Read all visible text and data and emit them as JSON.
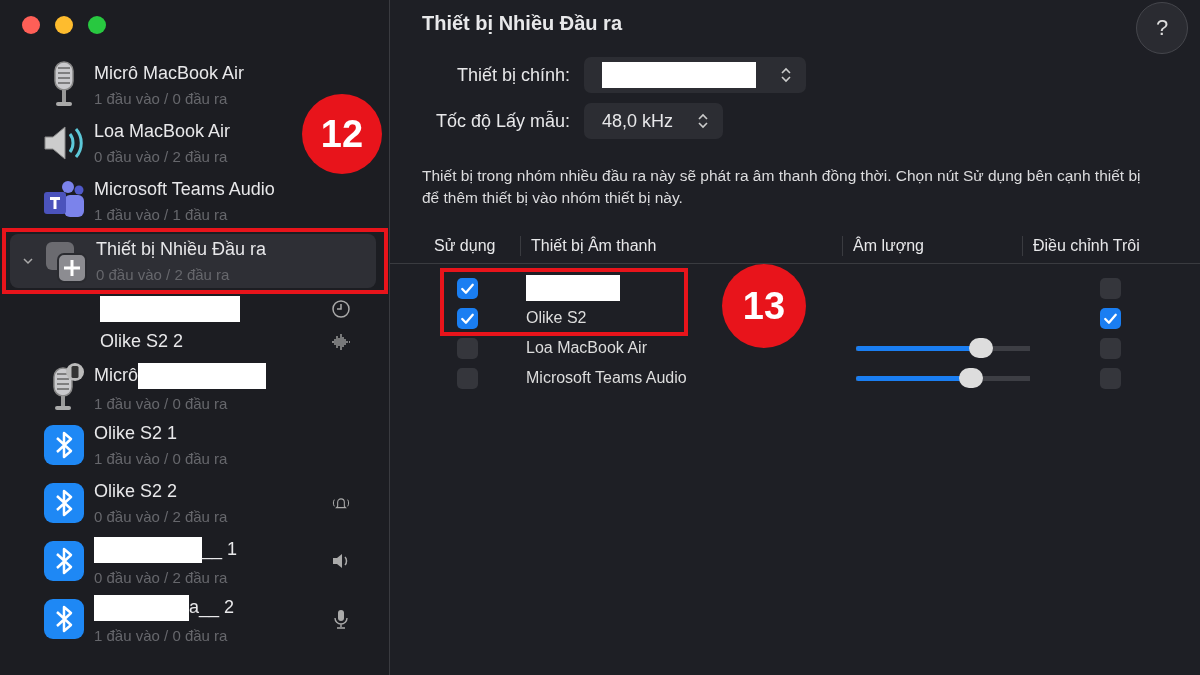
{
  "sidebar": {
    "items": [
      {
        "kind": "mic",
        "name": "Micrô MacBook Air",
        "io": "1 đầu vào / 0 đầu ra",
        "selected": false
      },
      {
        "kind": "speaker",
        "name": "Loa MacBook Air",
        "io": "0 đầu vào / 2 đầu ra",
        "selected": false
      },
      {
        "kind": "teams",
        "name": "Microsoft Teams Audio",
        "io": "1 đầu vào / 1 đầu ra",
        "selected": false
      },
      {
        "kind": "aggregate",
        "name": "Thiết bị Nhiều Đầu ra",
        "io": "0 đầu vào / 2 đầu ra",
        "selected": true,
        "expanded": true,
        "children": [
          {
            "kind": "hidden"
          },
          {
            "kind": "named",
            "name": "Olike S2 2"
          }
        ]
      },
      {
        "kind": "phonemic",
        "name": "Micrô",
        "io": "1 đầu vào / 0 đầu ra",
        "selected": false
      },
      {
        "kind": "bluetooth",
        "name": "Olike S2 1",
        "io": "1 đầu vào / 0 đầu ra",
        "selected": false
      },
      {
        "kind": "bluetooth",
        "name": "Olike S2 2",
        "io": "0 đầu vào / 2 đầu ra",
        "selected": false
      },
      {
        "kind": "bluetooth",
        "name": "__ 1",
        "io": "0 đầu vào / 2 đầu ra",
        "selected": false
      },
      {
        "kind": "bluetooth",
        "name": "a__ 2",
        "io": "1 đầu vào / 0 đầu ra",
        "selected": false
      }
    ]
  },
  "detail": {
    "title": "Thiết bị Nhiều Đầu ra",
    "help": "?",
    "fields": [
      {
        "label": "Thiết bị chính:"
      },
      {
        "label": "Tốc độ Lấy mẫu:",
        "value": "48,0 kHz"
      }
    ],
    "description": "Thiết bị trong nhóm nhiều đầu ra này sẽ phát ra âm thanh đồng thời. Chọn nút Sử dụng bên cạnh thiết bị để thêm thiết bị vào nhóm thiết bị này.",
    "table": {
      "columns": [
        "Sử dụng",
        "Thiết bị Âm thanh",
        "Âm lượng",
        "Điều chỉnh Trôi"
      ],
      "rows": [
        {
          "use": true,
          "drift": false
        },
        {
          "use": true,
          "name": "Olike S2",
          "drift": true
        },
        {
          "use": false,
          "name": "Loa MacBook Air",
          "level": 0.72,
          "drift": false
        },
        {
          "use": false,
          "name": "Microsoft Teams Audio",
          "level": 0.66,
          "drift": false
        }
      ]
    }
  },
  "annotations": [
    {
      "label": "12"
    },
    {
      "label": "13"
    }
  ]
}
